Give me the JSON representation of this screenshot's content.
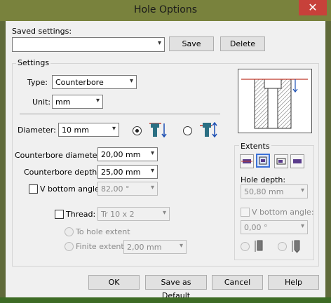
{
  "window": {
    "title": "Hole Options",
    "close_glyph": "✕"
  },
  "saved": {
    "label": "Saved settings:",
    "value": "",
    "save": "Save",
    "delete": "Delete"
  },
  "settings": {
    "title": "Settings",
    "type_label": "Type:",
    "type_value": "Counterbore",
    "unit_label": "Unit:",
    "unit_value": "mm",
    "diameter_label": "Diameter:",
    "diameter_value": "10 mm",
    "cb_diameter_label": "Counterbore diameter:",
    "cb_diameter_value": "20,00 mm",
    "cb_depth_label": "Counterbore depth:",
    "cb_depth_value": "25,00 mm",
    "vbottom_label": "V bottom angle:",
    "vbottom_value": "82,00 °",
    "thread_label": "Thread:",
    "thread_value": "Tr 10 x 2",
    "to_hole_extent": "To hole extent",
    "finite_extent": "Finite extent",
    "finite_value": "2,00 mm"
  },
  "extents": {
    "title": "Extents",
    "hole_depth_label": "Hole depth:",
    "hole_depth_value": "50,80 mm",
    "vbottom_label": "V bottom angle:",
    "vbottom_value": "0,00 °"
  },
  "footer": {
    "ok": "OK",
    "save_default": "Save as Default",
    "cancel": "Cancel",
    "help": "Help"
  },
  "colors": {
    "accent": "#2a6fd6",
    "title_bar": "#79823d",
    "close": "#c7413a"
  }
}
